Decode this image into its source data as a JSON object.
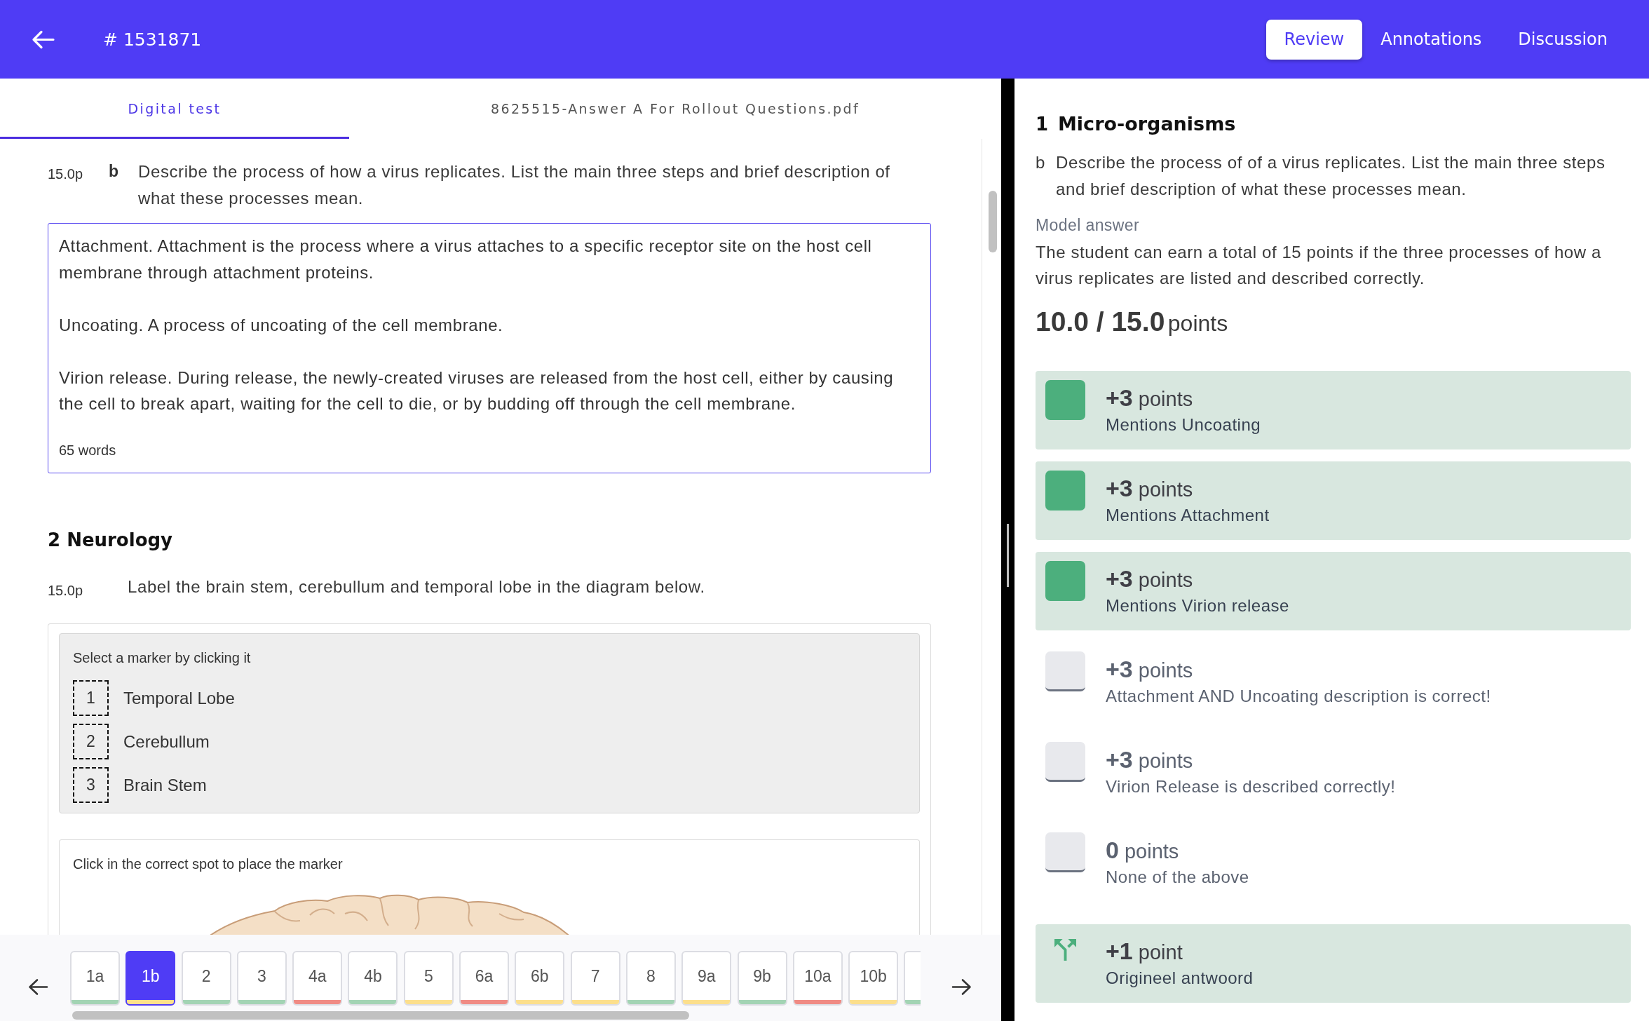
{
  "header": {
    "title": "# 1531871",
    "tabs": [
      {
        "label": "Review",
        "selected": true
      },
      {
        "label": "Annotations",
        "selected": false
      },
      {
        "label": "Discussion",
        "selected": false
      }
    ]
  },
  "document_tabs": [
    {
      "label": "Digital test",
      "selected": true
    },
    {
      "label": "8625515-Answer A For Rollout Questions.pdf",
      "selected": false
    }
  ],
  "question_1b": {
    "points": "15.0p",
    "part": "b",
    "text": "Describe the process of how a virus replicates. List the main three steps and brief description of what these processes mean.",
    "answer": {
      "paragraphs": [
        "Attachment. Attachment is the process where a virus attaches to a specific receptor site on the host cell membrane through attachment proteins.",
        "Uncoating. A process of uncoating of the cell membrane.",
        "Virion release. During release, the newly-created viruses are released from the host cell, either by causing the cell to break apart, waiting for the cell to die, or by budding off through the cell membrane."
      ],
      "word_count": "65 words"
    }
  },
  "section_2": {
    "title": "2 Neurology",
    "points": "15.0p",
    "text": "Label the brain stem, cerebullum and temporal lobe in the diagram below.",
    "marker_panel": {
      "instruction": "Select a marker by clicking it",
      "markers": [
        {
          "number": "1",
          "label": "Temporal Lobe"
        },
        {
          "number": "2",
          "label": "Cerebullum"
        },
        {
          "number": "3",
          "label": "Brain Stem"
        }
      ]
    },
    "placement_panel": {
      "instruction": "Click in the correct spot to place the marker"
    }
  },
  "question_nav": {
    "items": [
      {
        "label": "1a",
        "selected": false,
        "color": "#a3d4b4"
      },
      {
        "label": "1b",
        "selected": true,
        "color": "#fcdf8c"
      },
      {
        "label": "2",
        "selected": false,
        "color": "#a3d4b4"
      },
      {
        "label": "3",
        "selected": false,
        "color": "#a3d4b4"
      },
      {
        "label": "4a",
        "selected": false,
        "color": "#f08b84"
      },
      {
        "label": "4b",
        "selected": false,
        "color": "#a3d4b4"
      },
      {
        "label": "5",
        "selected": false,
        "color": "#fcdf8c"
      },
      {
        "label": "6a",
        "selected": false,
        "color": "#f08b84"
      },
      {
        "label": "6b",
        "selected": false,
        "color": "#fcdf8c"
      },
      {
        "label": "7",
        "selected": false,
        "color": "#fcdf8c"
      },
      {
        "label": "8",
        "selected": false,
        "color": "#a3d4b4"
      },
      {
        "label": "9a",
        "selected": false,
        "color": "#fcdf8c"
      },
      {
        "label": "9b",
        "selected": false,
        "color": "#a3d4b4"
      },
      {
        "label": "10a",
        "selected": false,
        "color": "#f08b84"
      },
      {
        "label": "10b",
        "selected": false,
        "color": "#fcdf8c"
      },
      {
        "selected": false,
        "color": "#a3d4b4"
      }
    ]
  },
  "review": {
    "section_number": "1",
    "section_title": "Micro-organisms",
    "part": "b",
    "question": "Describe the process of of a virus replicates. List the main three steps and brief description of what these processes mean.",
    "model_answer_label": "Model answer",
    "model_answer": "The student can earn a total of 15 points if the three processes of how a virus replicates are listed and described correctly.",
    "score": "10.0 / 15.0",
    "score_unit": "points",
    "criteria": [
      {
        "kind": "checkbox",
        "checked": true,
        "amount": "+3",
        "unit": "points",
        "description": "Mentions Uncoating"
      },
      {
        "kind": "checkbox",
        "checked": true,
        "amount": "+3",
        "unit": "points",
        "description": "Mentions Attachment"
      },
      {
        "kind": "checkbox",
        "checked": true,
        "amount": "+3",
        "unit": "points",
        "description": "Mentions Virion release"
      },
      {
        "kind": "checkbox",
        "checked": false,
        "amount": "+3",
        "unit": "points",
        "description": "Attachment AND Uncoating description is correct!"
      },
      {
        "kind": "checkbox",
        "checked": false,
        "amount": "+3",
        "unit": "points",
        "description": "Virion Release is described correctly!"
      },
      {
        "kind": "checkbox",
        "checked": false,
        "amount": "0",
        "unit": "points",
        "description": "None of the above"
      },
      {
        "kind": "adjustment",
        "amount": "+1",
        "unit": "point",
        "description": "Origineel antwoord"
      }
    ]
  }
}
